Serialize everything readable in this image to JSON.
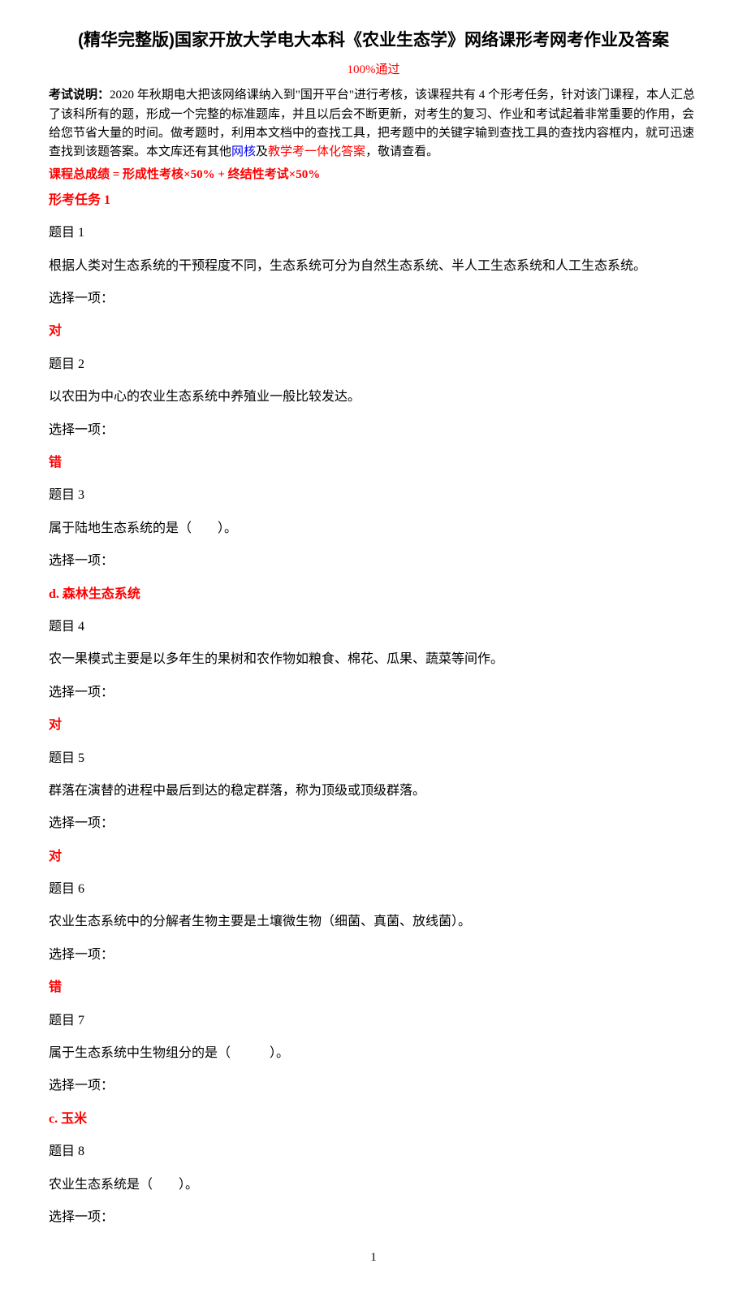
{
  "title": "(精华完整版)国家开放大学电大本科《农业生态学》网络课形考网考作业及答案",
  "pass_rate": "100%通过",
  "intro_label": "考试说明：",
  "intro_text_1": "2020 年秋期电大把该网络课纳入到\"国开平台\"进行考核，该课程共有 4 个形考任务，针对该门课程，本人汇总了该科所有的题，形成一个完整的标准题库，并且以后会不断更新，对考生的复习、作业和考试起着非常重要的作用，会给您节省大量的时间。做考题时，利用本文档中的查找工具，把考题中的关键字输到查找工具的查找内容框内，就可迅速查找到该题答案。本文库还有其他",
  "intro_blue_1": "网核",
  "intro_text_2": "及",
  "intro_red_1": "教学考一体化答案",
  "intro_text_3": "，敬请查看。",
  "grade_formula": "课程总成绩 = 形成性考核×50% + 终结性考试×50%",
  "task_header": "形考任务 1",
  "select_label": "选择一项：",
  "questions": [
    {
      "num": "题目 1",
      "text": "根据人类对生态系统的干预程度不同，生态系统可分为自然生态系统、半人工生态系统和人工生态系统。",
      "answer": "对"
    },
    {
      "num": "题目 2",
      "text": "以农田为中心的农业生态系统中养殖业一般比较发达。",
      "answer": "错"
    },
    {
      "num": "题目 3",
      "text": "属于陆地生态系统的是（　　）。",
      "answer": "d. 森林生态系统"
    },
    {
      "num": "题目 4",
      "text": "农一果模式主要是以多年生的果树和农作物如粮食、棉花、瓜果、蔬菜等间作。",
      "answer": "对"
    },
    {
      "num": "题目 5",
      "text": "群落在演替的进程中最后到达的稳定群落，称为顶级或顶级群落。",
      "answer": "对"
    },
    {
      "num": "题目 6",
      "text": "农业生态系统中的分解者生物主要是土壤微生物（细菌、真菌、放线菌）。",
      "answer": "错"
    },
    {
      "num": "题目 7",
      "text": "属于生态系统中生物组分的是（　　　）。",
      "answer": "c. 玉米"
    },
    {
      "num": "题目 8",
      "text": "农业生态系统是（　　）。",
      "answer": ""
    }
  ],
  "page_number": "1"
}
